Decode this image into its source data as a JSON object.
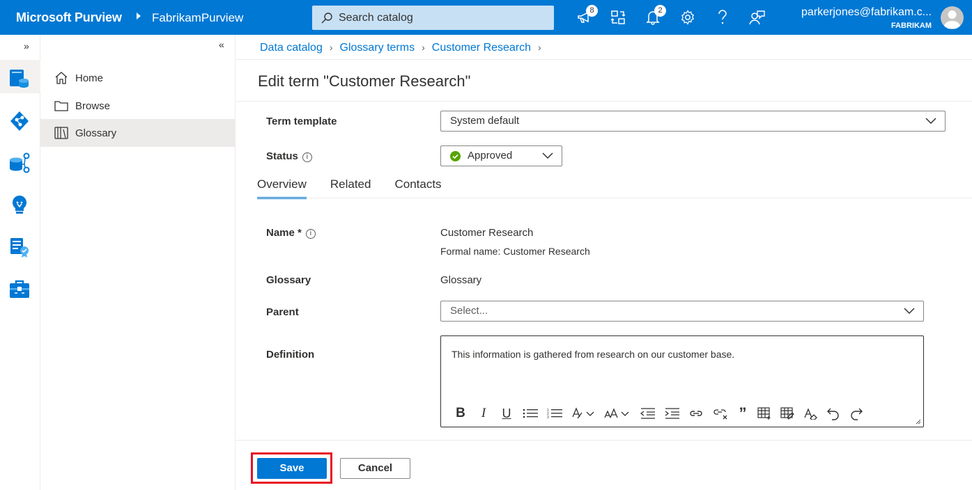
{
  "topbar": {
    "brand": "Microsoft Purview",
    "tenant": "FabrikamPurview",
    "search_placeholder": "Search catalog",
    "notifications_badge": "8",
    "alerts_badge": "2",
    "user_email": "parkerjones@fabrikam.c...",
    "user_org": "FABRIKAM",
    "accent": "#0078d4"
  },
  "rail": {
    "items": [
      "data-catalog-icon",
      "data-map-icon",
      "data-estate-icon",
      "insights-icon",
      "policy-icon",
      "management-icon"
    ]
  },
  "nav": {
    "items": [
      {
        "label": "Home",
        "icon": "home-icon"
      },
      {
        "label": "Browse",
        "icon": "folder-icon"
      },
      {
        "label": "Glossary",
        "icon": "book-icon"
      }
    ]
  },
  "breadcrumb": {
    "items": [
      "Data catalog",
      "Glossary terms",
      "Customer Research"
    ]
  },
  "page": {
    "title": "Edit term \"Customer Research\"",
    "term_template_label": "Term template",
    "term_template_value": "System default",
    "status_label": "Status",
    "status_value": "Approved",
    "status_color": "#57a300"
  },
  "tabs": [
    "Overview",
    "Related",
    "Contacts"
  ],
  "overview": {
    "name_label": "Name *",
    "name_value": "Customer Research",
    "formal_name": "Formal name: Customer Research",
    "glossary_label": "Glossary",
    "glossary_value": "Glossary",
    "parent_label": "Parent",
    "parent_placeholder": "Select...",
    "definition_label": "Definition",
    "definition_text": "This information is gathered from research on our customer base."
  },
  "actions": {
    "save": "Save",
    "cancel": "Cancel",
    "highlight_color": "#e81123"
  }
}
